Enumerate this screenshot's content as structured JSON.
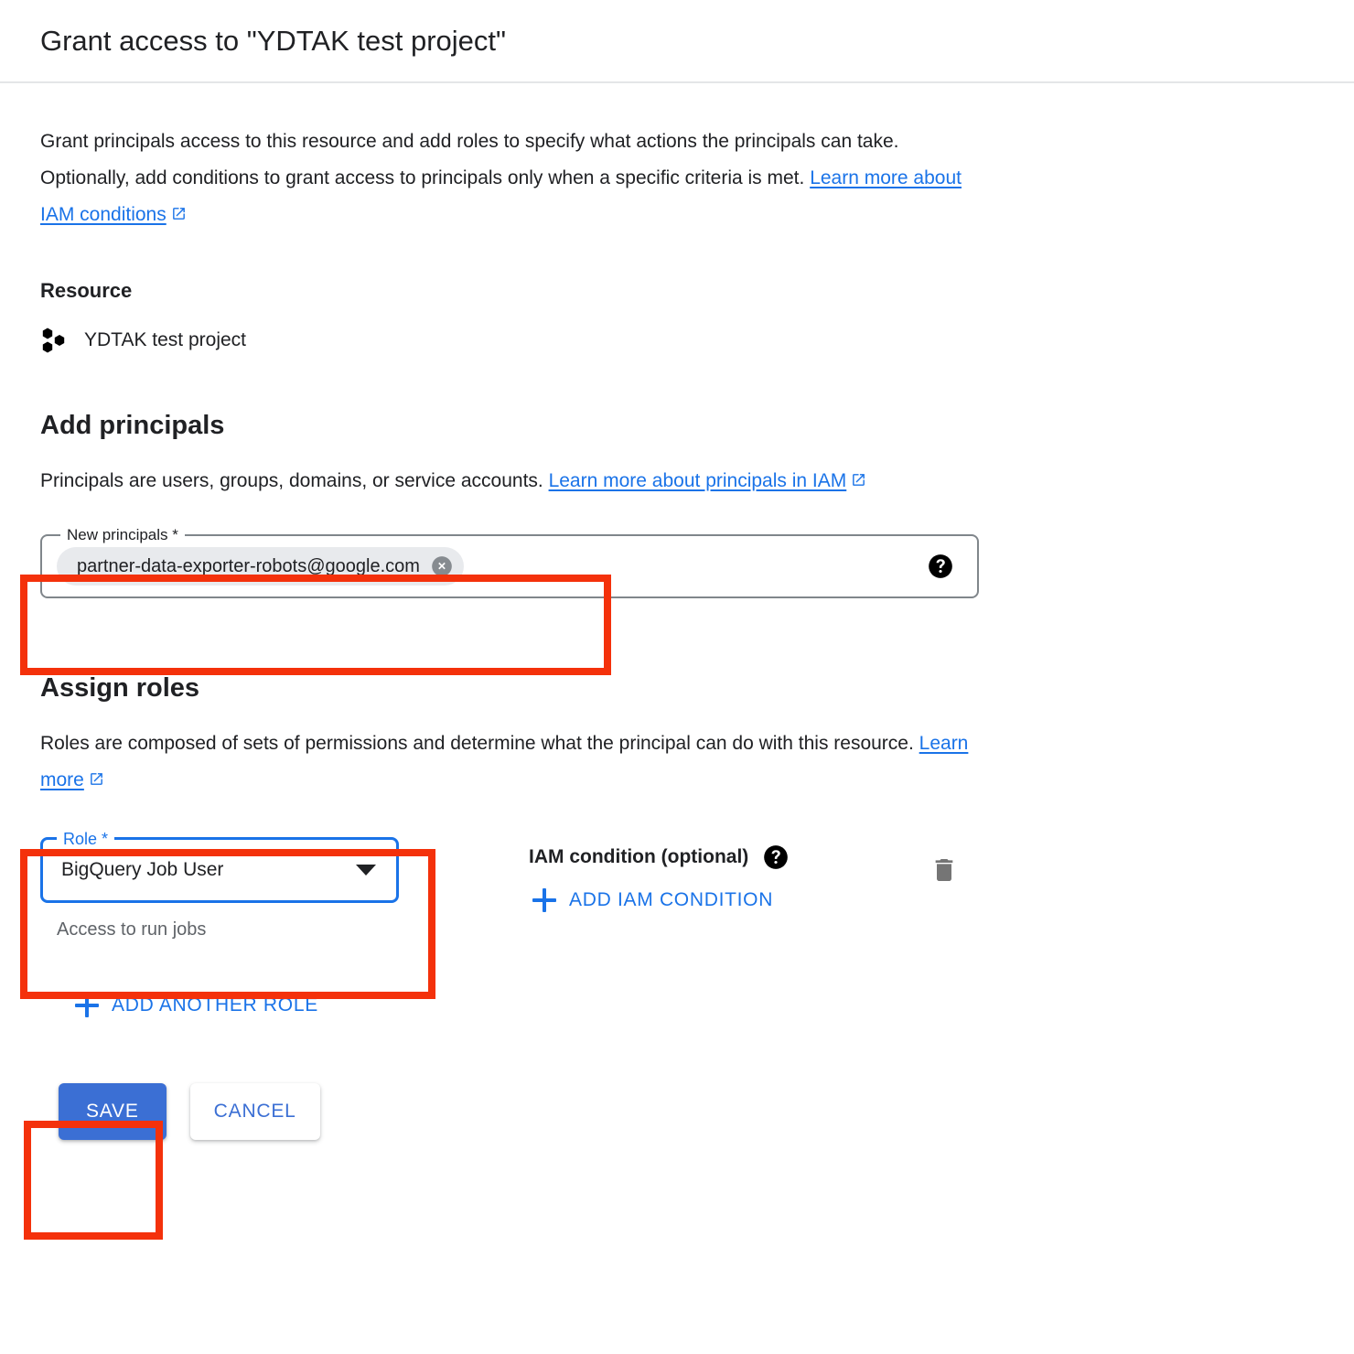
{
  "dialog": {
    "title": "Grant access to \"YDTAK test project\""
  },
  "intro": {
    "text_before_link": "Grant principals access to this resource and add roles to specify what actions the principals can take. Optionally, add conditions to grant access to principals only when a specific criteria is met. ",
    "link_label": "Learn more about IAM conditions",
    "link_icon": "external-link-icon"
  },
  "resource": {
    "heading": "Resource",
    "icon": "gcp-project-icon",
    "name": "YDTAK test project"
  },
  "add_principals": {
    "heading": "Add principals",
    "desc_before_link": "Principals are users, groups, domains, or service accounts. ",
    "link_label": "Learn more about principals in IAM",
    "link_icon": "external-link-icon",
    "field": {
      "label": "New principals *",
      "chip_value": "partner-data-exporter-robots@google.com",
      "chip_remove_icon": "close-circle-icon",
      "help_icon": "help-icon"
    }
  },
  "assign_roles": {
    "heading": "Assign roles",
    "desc_before_link": "Roles are composed of sets of permissions and determine what the principal can do with this resource. ",
    "link_label": "Learn more",
    "link_icon": "external-link-icon",
    "role": {
      "label": "Role *",
      "selected_value": "BigQuery Job User",
      "hint": "Access to run jobs",
      "caret_icon": "chevron-down-icon"
    },
    "iam_condition": {
      "label": "IAM condition (optional)",
      "help_icon": "help-icon",
      "add_label": "ADD IAM CONDITION",
      "add_icon": "plus-icon"
    },
    "delete_icon": "trash-icon",
    "add_another_role_label": "ADD ANOTHER ROLE",
    "add_another_role_icon": "plus-icon"
  },
  "actions": {
    "save_label": "SAVE",
    "cancel_label": "CANCEL"
  },
  "annotations": {
    "highlight_color": "#f4310b",
    "targets": [
      "new-principals-field",
      "role-select-group",
      "save-button"
    ]
  },
  "colors": {
    "accent_blue": "#1a73e8",
    "button_blue": "#3b6fd4",
    "text_primary": "#202124",
    "text_secondary": "#5f6368",
    "chip_bg": "#e8eaed",
    "border_gray": "#80868b",
    "divider": "#e4e6e8"
  }
}
